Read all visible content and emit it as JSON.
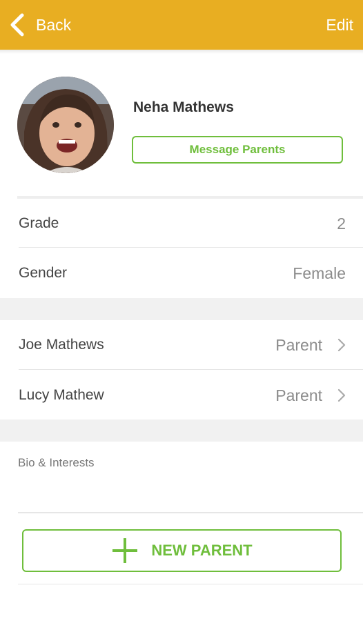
{
  "header": {
    "back_label": "Back",
    "edit_label": "Edit",
    "bar_color": "#E8AE22"
  },
  "profile": {
    "name": "Neha Mathews",
    "message_button_label": "Message Parents",
    "avatar_icon": "student-photo"
  },
  "details": [
    {
      "label": "Grade",
      "value": "2"
    },
    {
      "label": "Gender",
      "value": "Female"
    }
  ],
  "parents": [
    {
      "name": "Joe Mathews",
      "role": "Parent"
    },
    {
      "name": "Lucy Mathew",
      "role": "Parent"
    }
  ],
  "bio": {
    "label": "Bio & Interests"
  },
  "actions": {
    "new_parent_label": "NEW PARENT",
    "accent_color": "#6FBE3C"
  }
}
